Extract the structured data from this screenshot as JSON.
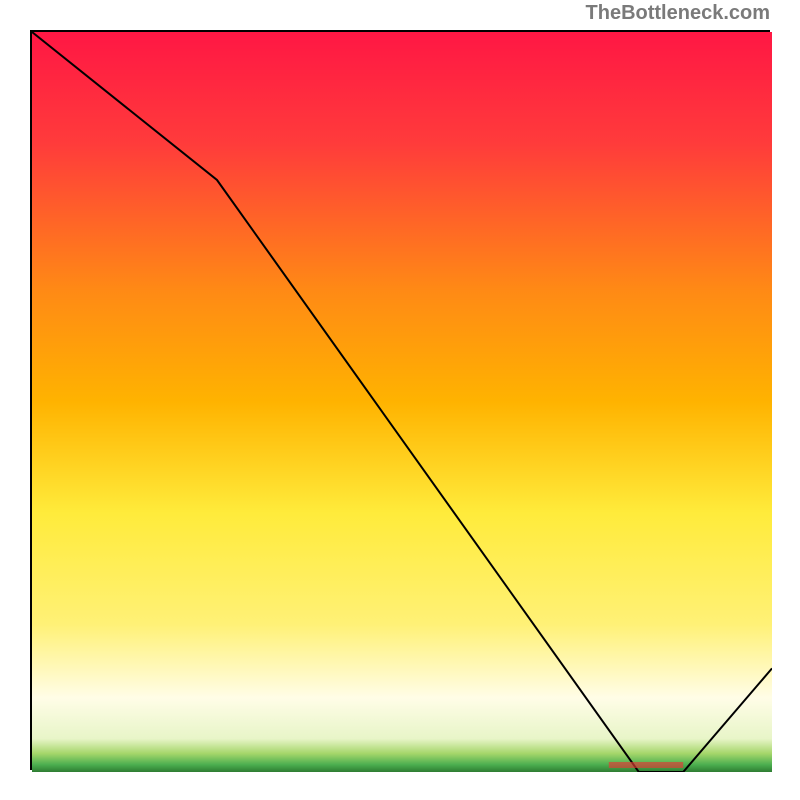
{
  "watermark": "TheBottleneck.com",
  "chart_data": {
    "type": "line",
    "title": "",
    "xlabel": "",
    "ylabel": "",
    "xlim": [
      0,
      100
    ],
    "ylim": [
      0,
      100
    ],
    "x": [
      0,
      25,
      82,
      88,
      100
    ],
    "values": [
      100,
      80,
      0,
      0,
      14
    ],
    "gradient_stops": [
      {
        "offset": 0.0,
        "color": "#ff1744"
      },
      {
        "offset": 0.15,
        "color": "#ff3b3b"
      },
      {
        "offset": 0.35,
        "color": "#ff8a15"
      },
      {
        "offset": 0.5,
        "color": "#ffb300"
      },
      {
        "offset": 0.65,
        "color": "#ffeb3b"
      },
      {
        "offset": 0.8,
        "color": "#fff176"
      },
      {
        "offset": 0.9,
        "color": "#fffde7"
      },
      {
        "offset": 0.955,
        "color": "#e8f5c8"
      },
      {
        "offset": 0.975,
        "color": "#a5d66a"
      },
      {
        "offset": 0.99,
        "color": "#4caf50"
      },
      {
        "offset": 1.0,
        "color": "#2e7d32"
      }
    ],
    "marker_label": "",
    "marker_color": "#e53935"
  }
}
